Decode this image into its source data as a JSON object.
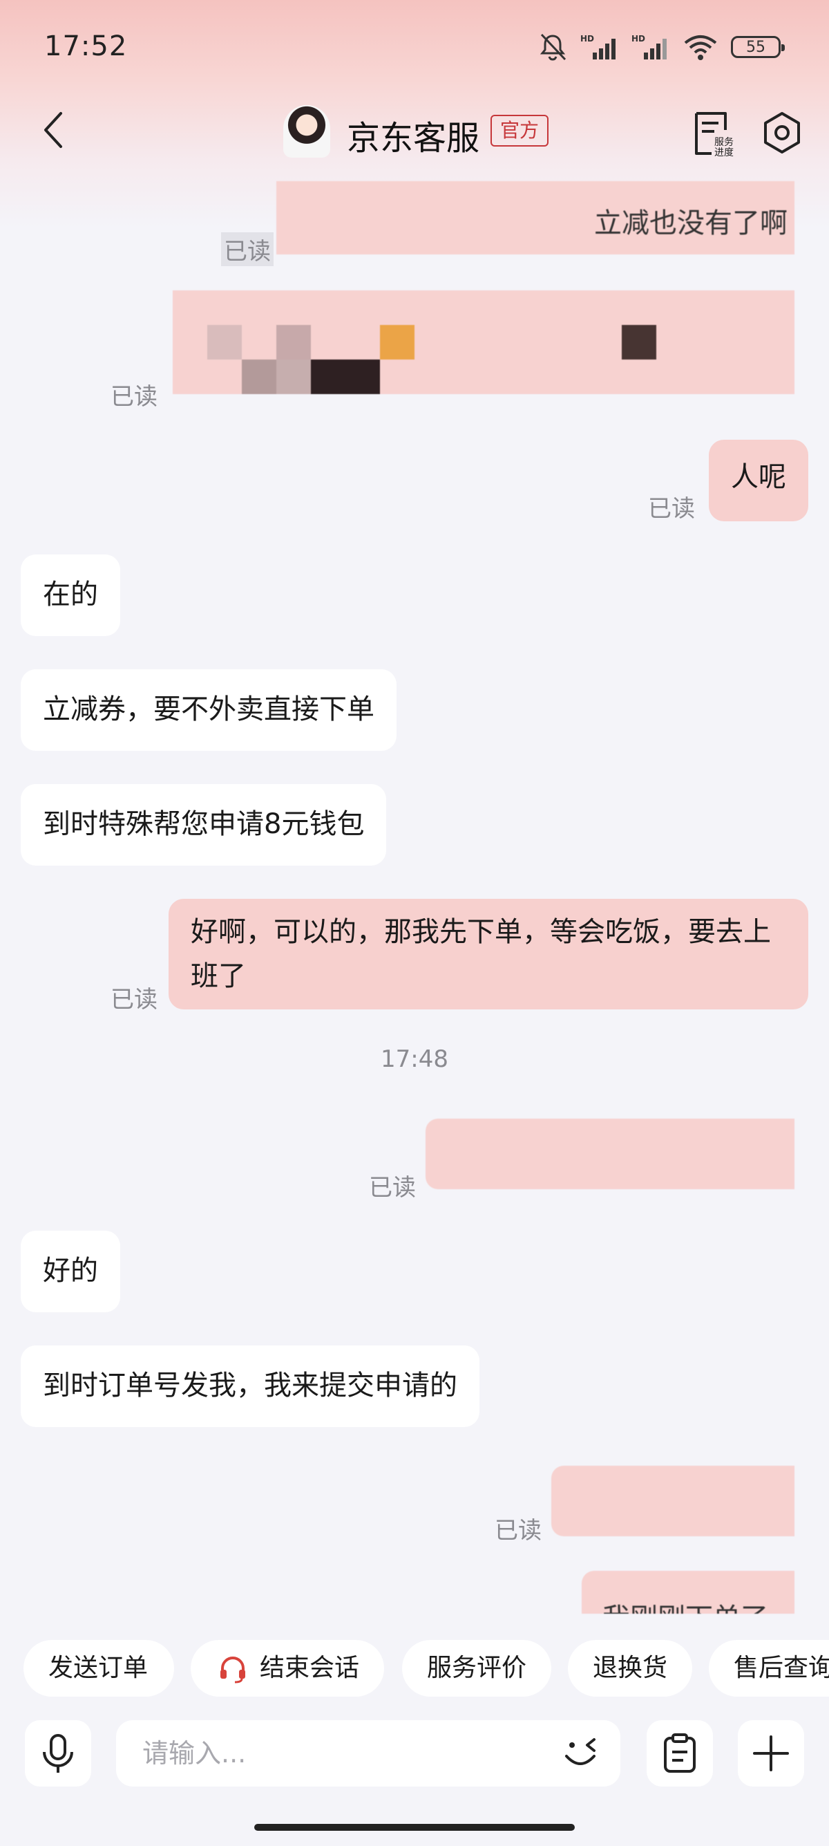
{
  "status_bar": {
    "time": "17:52",
    "battery": "55"
  },
  "header": {
    "title": "京东客服",
    "official_badge": "官方",
    "service_progress_label": "服务进度"
  },
  "read_label": "已读",
  "messages": {
    "out_partial_top": "立减也没有了啊",
    "out_renne": "人呢",
    "in_zaide": "在的",
    "in_lijian": "立减券，要不外卖直接下单",
    "in_daoshi": "到时特殊帮您申请8元钱包",
    "out_haoa": "好啊，可以的，那我先下单，等会吃饭，要去上班了",
    "timestamp": "17:48",
    "in_haode": "好的",
    "in_dingdan": "到时订单号发我，我来提交申请的",
    "out_partial_bottom": "我刚刚下单了"
  },
  "quick_replies": [
    "发送订单",
    "结束会话",
    "服务评价",
    "退换货",
    "售后查询"
  ],
  "input": {
    "placeholder": "请输入..."
  },
  "colors": {
    "accent": "#c6373a",
    "bubble_out": "#f7d0ce",
    "bubble_in": "#ffffff",
    "background": "#f4f4f9"
  }
}
